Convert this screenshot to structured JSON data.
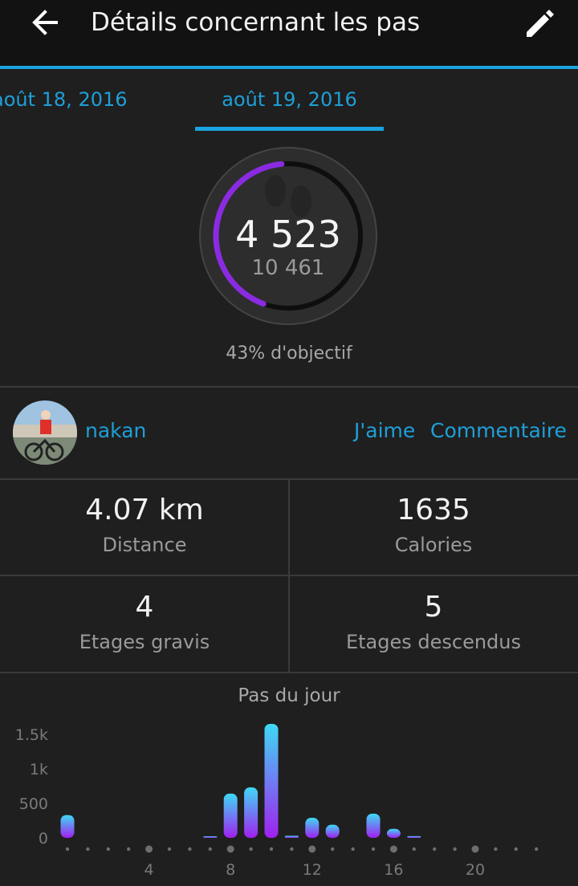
{
  "header": {
    "title": "Détails concernant les pas",
    "back_icon": "arrow-left-icon",
    "edit_icon": "pencil-icon"
  },
  "tabs": {
    "previous": "août 18, 2016",
    "current": "août 19, 2016"
  },
  "steps": {
    "value": "4 523",
    "goal": "10 461",
    "progress": 0.43,
    "goal_label": "43% d'objectif"
  },
  "social": {
    "username": "nakan",
    "like_label": "J'aime",
    "comment_label": "Commentaire"
  },
  "stats": {
    "distance_value": "4.07 km",
    "distance_label": "Distance",
    "calories_value": "1635",
    "calories_label": "Calories",
    "floors_up_value": "4",
    "floors_up_label": "Etages gravis",
    "floors_down_value": "5",
    "floors_down_label": "Etages descendus"
  },
  "colors": {
    "accent": "#1aa3df",
    "ring_progress": "#8a2be2",
    "bar_top": "#3fd9f5",
    "bar_bottom": "#a020f0"
  },
  "chart_data": {
    "type": "bar",
    "title": "Pas du jour",
    "x": [
      0,
      1,
      2,
      3,
      4,
      5,
      6,
      7,
      8,
      9,
      10,
      11,
      12,
      13,
      14,
      15,
      16,
      17,
      18,
      19,
      20,
      21,
      22,
      23
    ],
    "values": [
      330,
      0,
      0,
      0,
      0,
      0,
      0,
      10,
      640,
      730,
      1650,
      30,
      290,
      190,
      0,
      350,
      130,
      25,
      0,
      0,
      0,
      0,
      0,
      0
    ],
    "ylim": [
      0,
      1650
    ],
    "yticks": [
      0,
      500,
      1000,
      1500
    ],
    "ytick_labels": [
      "0",
      "500",
      "1k",
      "1.5k"
    ],
    "xticks": [
      4,
      8,
      12,
      16,
      20
    ],
    "xtick_labels": [
      "4",
      "8",
      "12",
      "16",
      "20"
    ],
    "grid": false
  }
}
